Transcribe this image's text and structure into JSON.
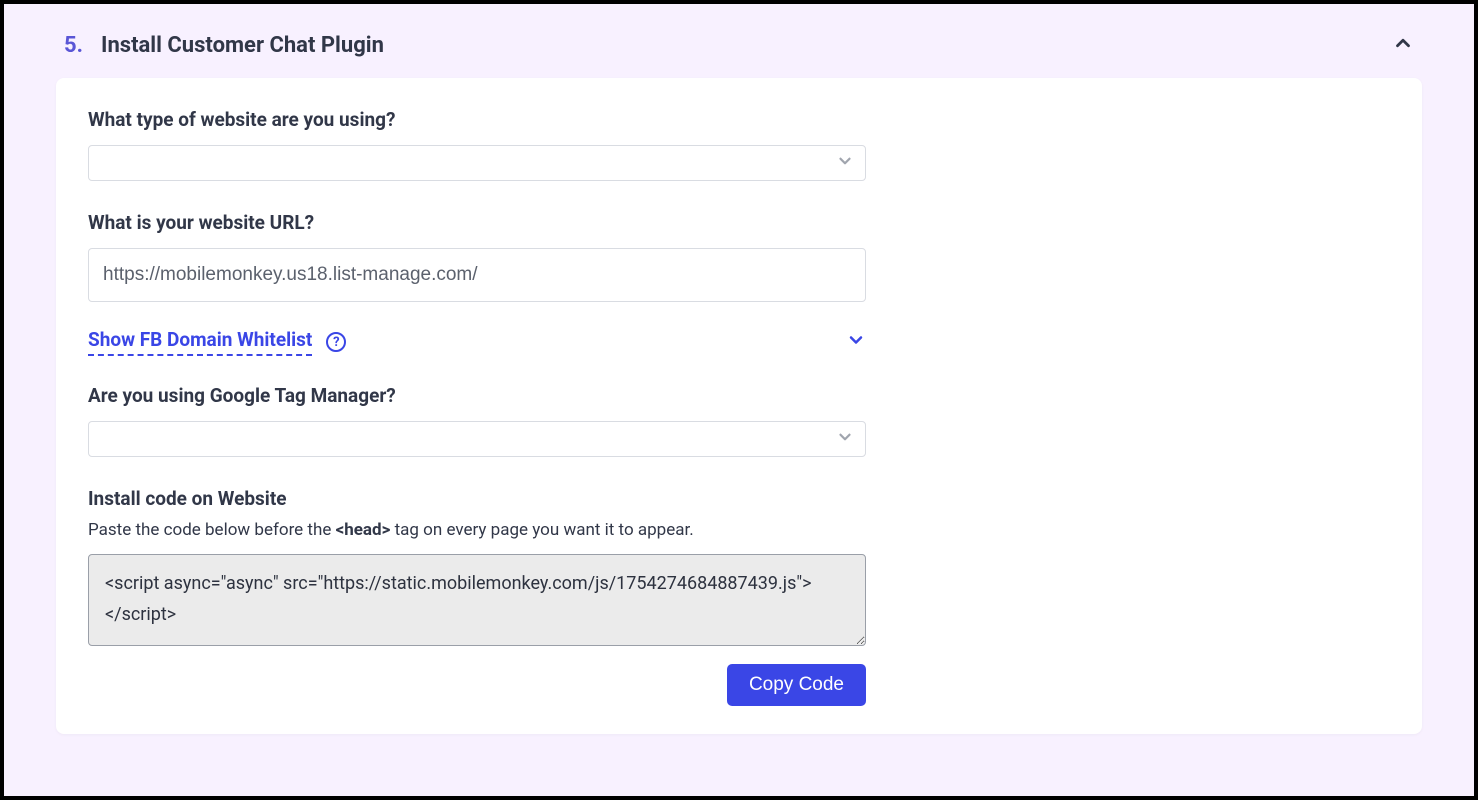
{
  "step": {
    "number": "5.",
    "title": "Install Customer Chat Plugin"
  },
  "form": {
    "website_type_label": "What type of website are you using?",
    "website_type_value": "",
    "website_url_label": "What is your website URL?",
    "website_url_value": "https://mobilemonkey.us18.list-manage.com/",
    "whitelist_link": "Show FB Domain Whitelist",
    "gtm_label": "Are you using Google Tag Manager?",
    "gtm_value": "",
    "install_label": "Install code on Website",
    "install_hint_pre": "Paste the code below before the ",
    "install_hint_tag": "<head>",
    "install_hint_post": " tag on every page you want it to appear.",
    "code_snippet": "<script async=\"async\" src=\"https://static.mobilemonkey.com/js/1754274684887439.js\"></script>",
    "copy_button": "Copy Code"
  }
}
